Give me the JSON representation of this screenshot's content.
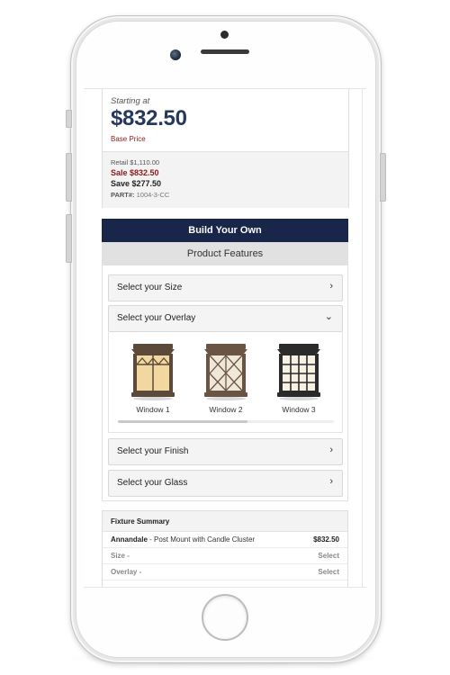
{
  "pricing": {
    "starting_label": "Starting at",
    "price": "$832.50",
    "base_label": "Base Price",
    "retail": "Retail $1,110.00",
    "sale": "Sale $832.50",
    "save": "Save $277.50",
    "part_label": "PART#:",
    "part_number": "1004-3-CC"
  },
  "builder": {
    "build_label": "Build Your Own",
    "features_label": "Product Features",
    "sections": [
      {
        "label": "Select your Size",
        "icon": "chevron-right-icon"
      },
      {
        "label": "Select your Overlay",
        "icon": "chevron-down-icon"
      },
      {
        "label": "Select your Finish",
        "icon": "chevron-right-icon"
      },
      {
        "label": "Select your Glass",
        "icon": "chevron-right-icon"
      }
    ],
    "overlay_options": [
      {
        "caption": "Window 1",
        "frame": "#5b4a3a",
        "glass": "#f2d8a0"
      },
      {
        "caption": "Window 2",
        "frame": "#6a5443",
        "glass": "#efe7d7"
      },
      {
        "caption": "Window 3",
        "frame": "#2b2b2b",
        "glass": "#f6f1e2"
      }
    ],
    "overlay_scroll_fraction": 0.6
  },
  "summary": {
    "title": "Fixture Summary",
    "product_name": "Annandale",
    "product_desc": " - Post Mount with Candle Cluster",
    "product_price": "$832.50",
    "rows": [
      {
        "label": "Size -",
        "action": "Select"
      },
      {
        "label": "Overlay -",
        "action": "Select"
      }
    ]
  },
  "colors": {
    "navy": "#18264a",
    "price_blue": "#26385e",
    "sale_red": "#8b1a1a"
  }
}
